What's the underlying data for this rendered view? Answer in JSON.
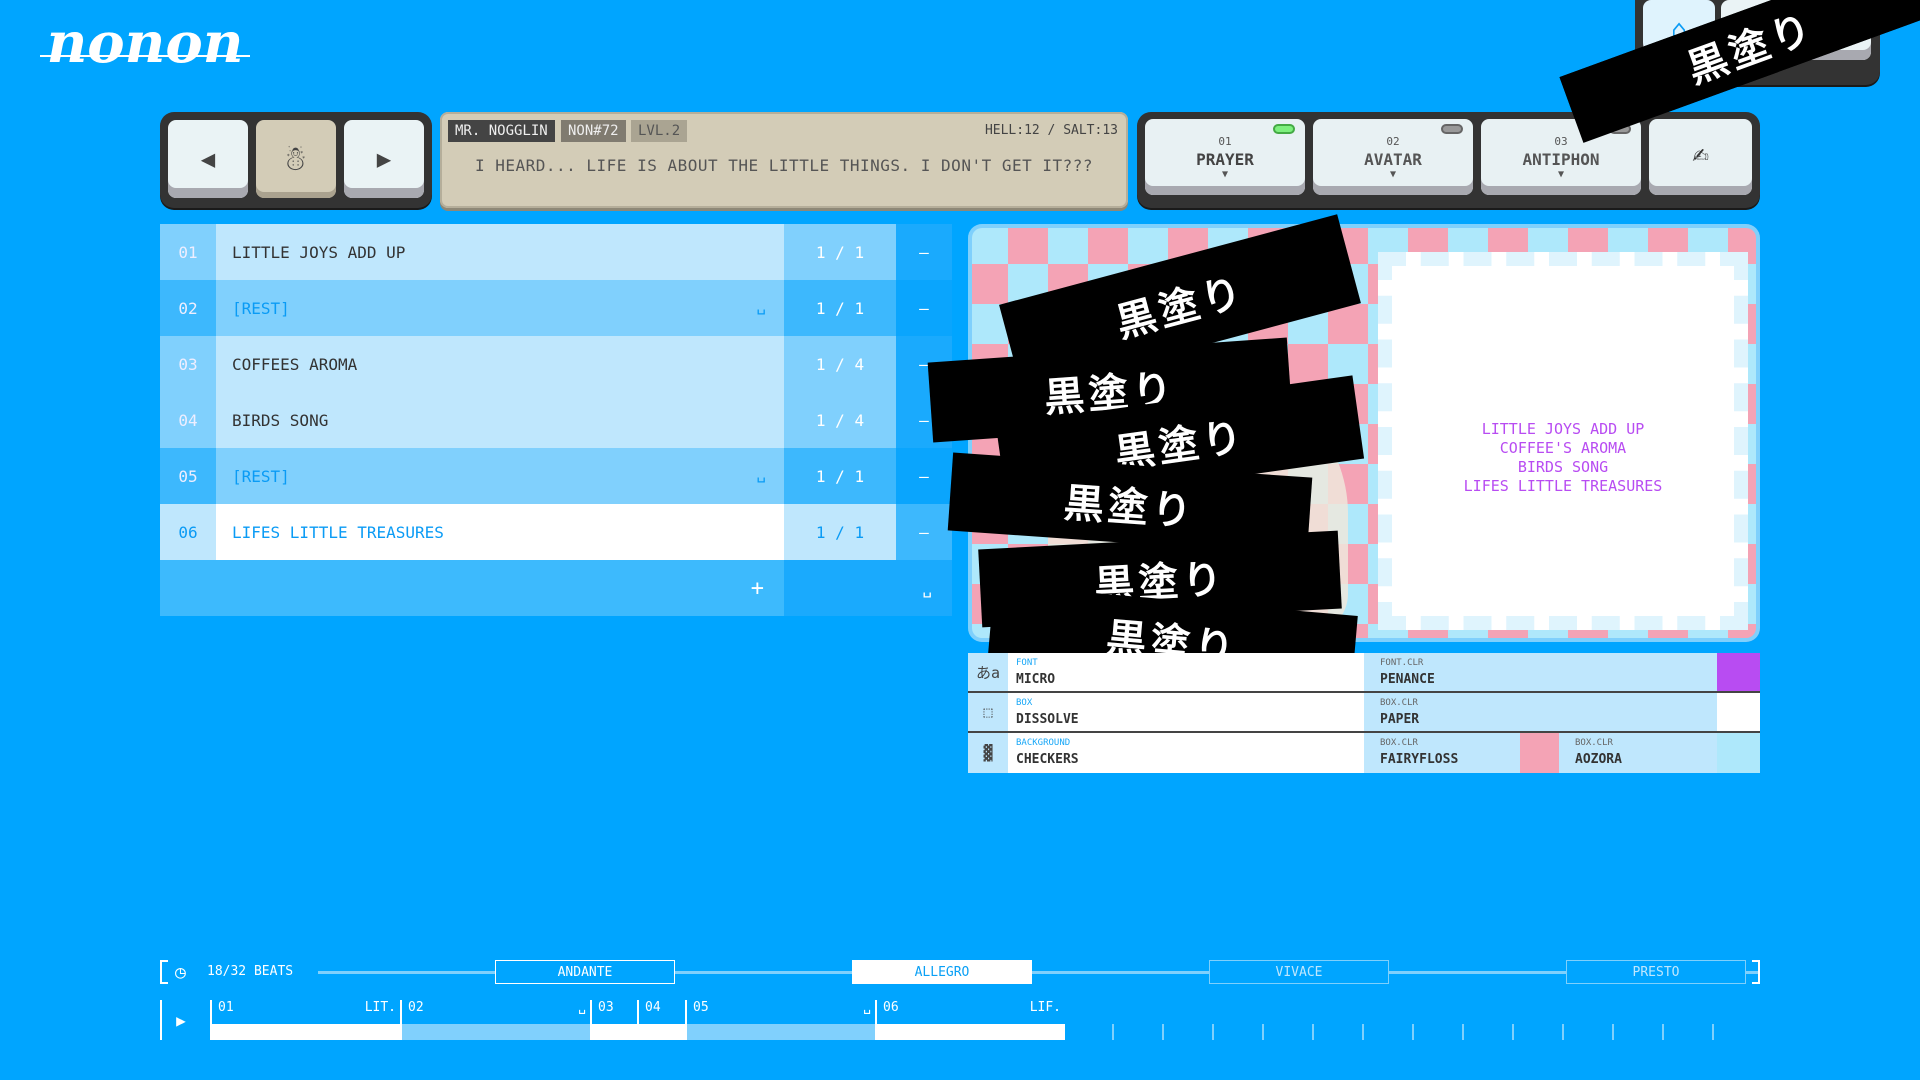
{
  "app": {
    "logo": "nonon"
  },
  "character": {
    "name": "MR. NOGGLIN",
    "id": "NON#72",
    "level": "LVL.2",
    "stats": "HELL:12 / SALT:13",
    "message": "I HEARD... LIFE IS ABOUT THE LITTLE THINGS. I DON'T GET IT???"
  },
  "toolbar": [
    {
      "num": "01",
      "label": "PRAYER",
      "active": true
    },
    {
      "num": "02",
      "label": "AVATAR",
      "active": false
    },
    {
      "num": "03",
      "label": "ANTIPHON",
      "active": false
    }
  ],
  "playlist": {
    "rows": [
      {
        "num": "01",
        "title": "LITTLE JOYS ADD UP",
        "count": "1 / 1",
        "type": "verse"
      },
      {
        "num": "02",
        "title": "[REST]",
        "count": "1 / 1",
        "type": "rest"
      },
      {
        "num": "03",
        "title": "COFFEES AROMA",
        "count": "1 / 4",
        "type": "verse"
      },
      {
        "num": "04",
        "title": "BIRDS SONG",
        "count": "1 / 4",
        "type": "verse"
      },
      {
        "num": "05",
        "title": "[REST]",
        "count": "1 / 1",
        "type": "rest"
      },
      {
        "num": "06",
        "title": "LIFES LITTLE TREASURES",
        "count": "1 / 1",
        "type": "selected"
      }
    ],
    "add": "+",
    "remove": "—",
    "space": "␣"
  },
  "preview": {
    "lyrics": [
      "LITTLE JOYS ADD UP",
      "COFFEE'S AROMA",
      "BIRDS SONG",
      "LIFES LITTLE TREASURES"
    ],
    "redaction": "黒塗り"
  },
  "settings": [
    {
      "icon": "あa",
      "label": "FONT",
      "value": "MICRO",
      "colors": [
        {
          "label": "FONT.CLR",
          "value": "PENANCE",
          "swatch": "#b84cf2"
        }
      ]
    },
    {
      "icon": "⬚",
      "label": "BOX",
      "value": "DISSOLVE",
      "colors": [
        {
          "label": "BOX.CLR",
          "value": "PAPER",
          "swatch": "#ffffff"
        }
      ]
    },
    {
      "icon": "▓",
      "label": "BACKGROUND",
      "value": "CHECKERS",
      "colors": [
        {
          "label": "BOX.CLR",
          "value": "FAIRYFLOSS",
          "swatch": "#f4a3b5"
        },
        {
          "label": "BOX.CLR",
          "value": "AOZORA",
          "swatch": "#aee8fb"
        }
      ]
    }
  ],
  "timeline": {
    "beats": "18/32 BEATS",
    "tempos": [
      "ANDANTE",
      "ALLEGRO",
      "VIVACE",
      "PRESTO"
    ],
    "selected_tempo": "ALLEGRO",
    "segments": [
      {
        "num": "01",
        "abbr": "LIT."
      },
      {
        "num": "02",
        "abbr": "␣"
      },
      {
        "num": "03",
        "abbr": ""
      },
      {
        "num": "04",
        "abbr": ""
      },
      {
        "num": "05",
        "abbr": "␣"
      },
      {
        "num": "06",
        "abbr": "LIF."
      }
    ]
  },
  "colors": {
    "background": "#00a5ff",
    "accent": "#b84cf2"
  }
}
